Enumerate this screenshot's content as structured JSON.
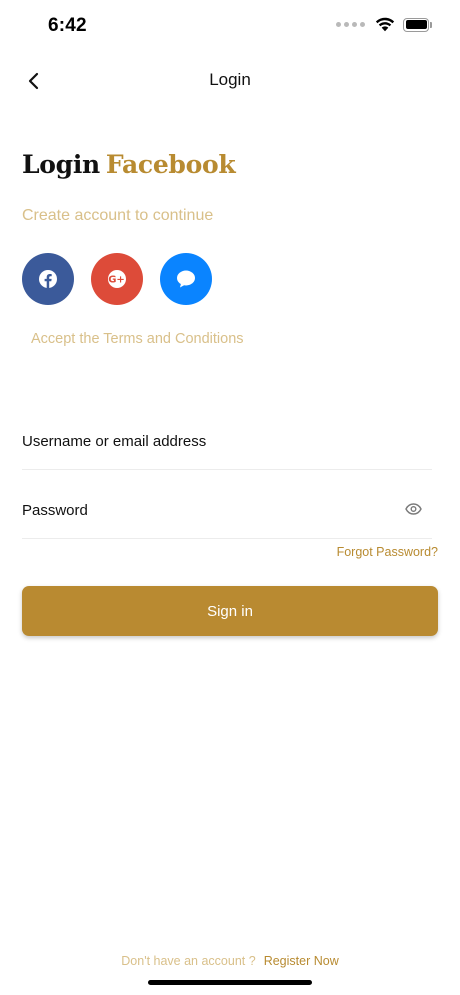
{
  "status_bar": {
    "time": "6:42",
    "icons": [
      "signal-dots-icon",
      "wifi-icon",
      "battery-icon"
    ]
  },
  "nav": {
    "title": "Login",
    "back_icon": "chevron-left-icon"
  },
  "heading": {
    "login": "Login",
    "brand": "Facebook"
  },
  "subtitle": "Create account to continue",
  "social": [
    {
      "name": "facebook",
      "icon": "facebook-icon",
      "color": "#3b5a9a"
    },
    {
      "name": "google-plus",
      "icon": "google-plus-icon",
      "color": "#dd4b39"
    },
    {
      "name": "messenger",
      "icon": "chat-bubble-icon",
      "color": "#0a84ff"
    }
  ],
  "terms": "Accept the Terms and Conditions",
  "form": {
    "username_placeholder": "Username or email address",
    "password_placeholder": "Password",
    "password_toggle_icon": "eye-icon",
    "forgot": "Forgot Password?",
    "signin": "Sign in"
  },
  "footer": {
    "question": "Don't have an account ?",
    "link": "Register Now"
  },
  "colors": {
    "accent": "#b98a31",
    "accent_light": "#d9c08a"
  }
}
